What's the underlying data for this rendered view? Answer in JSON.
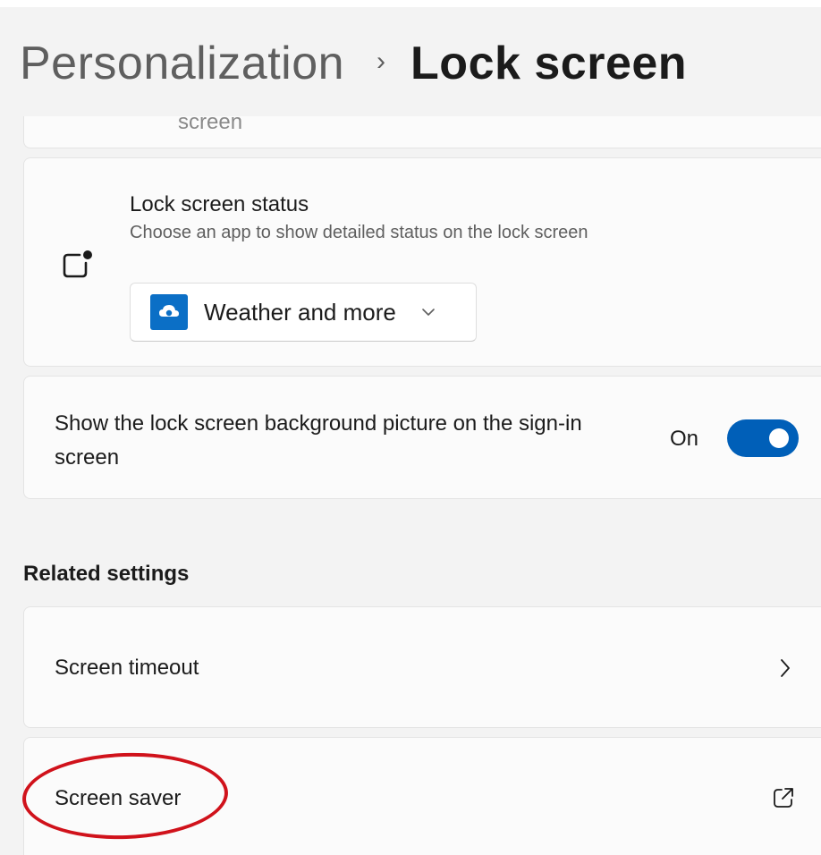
{
  "header": {
    "parent": "Personalization",
    "separator": "›",
    "current": "Lock screen"
  },
  "previous_card": {
    "text": "screen"
  },
  "lock_screen_status": {
    "icon": "lock-status-icon",
    "title": "Lock screen status",
    "description": "Choose an app to show detailed status on the lock screen",
    "dropdown": {
      "app_icon": "weather-app-icon",
      "selected": "Weather and more"
    }
  },
  "background_setting": {
    "text": "Show the lock screen background picture on the sign-in screen",
    "toggle_state": "On",
    "toggle_on": true
  },
  "related": {
    "heading": "Related settings",
    "items": [
      {
        "label": "Screen timeout",
        "icon": "chevron-right-icon"
      },
      {
        "label": "Screen saver",
        "icon": "external-link-icon"
      }
    ]
  },
  "colors": {
    "accent": "#005fb8",
    "annotation": "#d0121b",
    "app_icon_bg": "#0b6fc6"
  }
}
